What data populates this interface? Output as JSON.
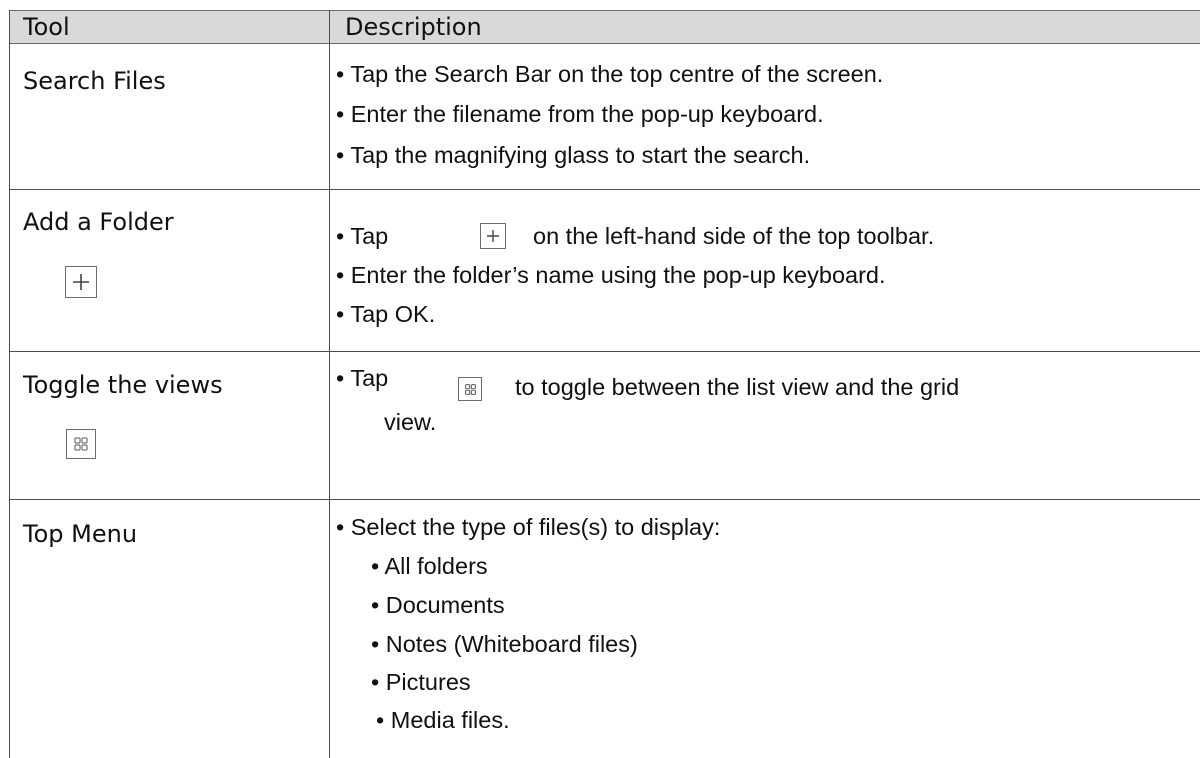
{
  "table": {
    "headers": {
      "tool": "Tool",
      "description": "Description"
    },
    "rows": [
      {
        "tool": "Search Files",
        "bullets": [
          "•    Tap the Search Bar on the top centre of the screen.",
          "• Enter the filename from the pop-up keyboard.",
          "• Tap the magnifying glass to start the search."
        ]
      },
      {
        "tool": "Add a Folder",
        "tool_icon": "plus-icon",
        "bullets": [
          "•     Tap",
          "on the left-hand side of the top toolbar.",
          "• Enter the folder’s name using the pop-up keyboard.",
          "• Tap OK."
        ]
      },
      {
        "tool": "Toggle the views",
        "tool_icon": "grid-view-icon",
        "bullets": [
          "• Tap",
          "to toggle between the list view and the grid",
          "view."
        ]
      },
      {
        "tool": "Top Menu",
        "bullets": [
          "• Select the type of files(s) to display:",
          "•    All folders",
          "• Documents",
          "• Notes (Whiteboard files)",
          "•     Pictures",
          "• Media files."
        ]
      }
    ]
  }
}
